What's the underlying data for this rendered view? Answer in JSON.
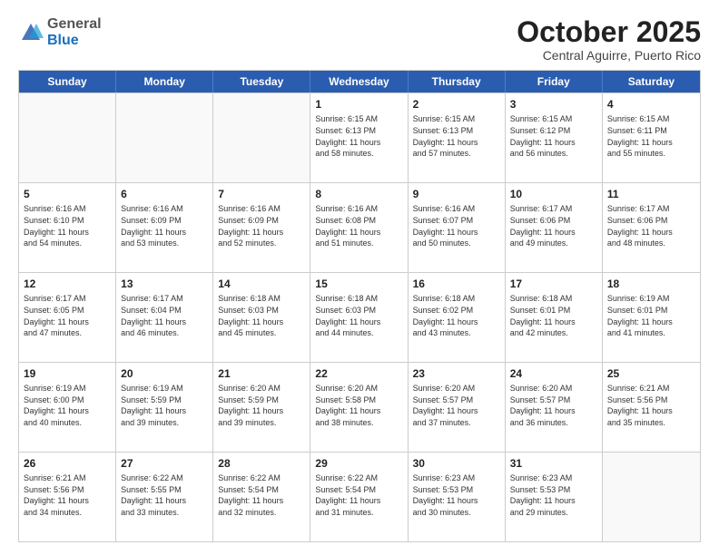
{
  "header": {
    "logo_general": "General",
    "logo_blue": "Blue",
    "month_title": "October 2025",
    "location": "Central Aguirre, Puerto Rico"
  },
  "weekdays": [
    "Sunday",
    "Monday",
    "Tuesday",
    "Wednesday",
    "Thursday",
    "Friday",
    "Saturday"
  ],
  "weeks": [
    [
      {
        "day": "",
        "info": "",
        "empty": true
      },
      {
        "day": "",
        "info": "",
        "empty": true
      },
      {
        "day": "",
        "info": "",
        "empty": true
      },
      {
        "day": "1",
        "info": "Sunrise: 6:15 AM\nSunset: 6:13 PM\nDaylight: 11 hours\nand 58 minutes.",
        "empty": false
      },
      {
        "day": "2",
        "info": "Sunrise: 6:15 AM\nSunset: 6:13 PM\nDaylight: 11 hours\nand 57 minutes.",
        "empty": false
      },
      {
        "day": "3",
        "info": "Sunrise: 6:15 AM\nSunset: 6:12 PM\nDaylight: 11 hours\nand 56 minutes.",
        "empty": false
      },
      {
        "day": "4",
        "info": "Sunrise: 6:15 AM\nSunset: 6:11 PM\nDaylight: 11 hours\nand 55 minutes.",
        "empty": false
      }
    ],
    [
      {
        "day": "5",
        "info": "Sunrise: 6:16 AM\nSunset: 6:10 PM\nDaylight: 11 hours\nand 54 minutes.",
        "empty": false
      },
      {
        "day": "6",
        "info": "Sunrise: 6:16 AM\nSunset: 6:09 PM\nDaylight: 11 hours\nand 53 minutes.",
        "empty": false
      },
      {
        "day": "7",
        "info": "Sunrise: 6:16 AM\nSunset: 6:09 PM\nDaylight: 11 hours\nand 52 minutes.",
        "empty": false
      },
      {
        "day": "8",
        "info": "Sunrise: 6:16 AM\nSunset: 6:08 PM\nDaylight: 11 hours\nand 51 minutes.",
        "empty": false
      },
      {
        "day": "9",
        "info": "Sunrise: 6:16 AM\nSunset: 6:07 PM\nDaylight: 11 hours\nand 50 minutes.",
        "empty": false
      },
      {
        "day": "10",
        "info": "Sunrise: 6:17 AM\nSunset: 6:06 PM\nDaylight: 11 hours\nand 49 minutes.",
        "empty": false
      },
      {
        "day": "11",
        "info": "Sunrise: 6:17 AM\nSunset: 6:06 PM\nDaylight: 11 hours\nand 48 minutes.",
        "empty": false
      }
    ],
    [
      {
        "day": "12",
        "info": "Sunrise: 6:17 AM\nSunset: 6:05 PM\nDaylight: 11 hours\nand 47 minutes.",
        "empty": false
      },
      {
        "day": "13",
        "info": "Sunrise: 6:17 AM\nSunset: 6:04 PM\nDaylight: 11 hours\nand 46 minutes.",
        "empty": false
      },
      {
        "day": "14",
        "info": "Sunrise: 6:18 AM\nSunset: 6:03 PM\nDaylight: 11 hours\nand 45 minutes.",
        "empty": false
      },
      {
        "day": "15",
        "info": "Sunrise: 6:18 AM\nSunset: 6:03 PM\nDaylight: 11 hours\nand 44 minutes.",
        "empty": false
      },
      {
        "day": "16",
        "info": "Sunrise: 6:18 AM\nSunset: 6:02 PM\nDaylight: 11 hours\nand 43 minutes.",
        "empty": false
      },
      {
        "day": "17",
        "info": "Sunrise: 6:18 AM\nSunset: 6:01 PM\nDaylight: 11 hours\nand 42 minutes.",
        "empty": false
      },
      {
        "day": "18",
        "info": "Sunrise: 6:19 AM\nSunset: 6:01 PM\nDaylight: 11 hours\nand 41 minutes.",
        "empty": false
      }
    ],
    [
      {
        "day": "19",
        "info": "Sunrise: 6:19 AM\nSunset: 6:00 PM\nDaylight: 11 hours\nand 40 minutes.",
        "empty": false
      },
      {
        "day": "20",
        "info": "Sunrise: 6:19 AM\nSunset: 5:59 PM\nDaylight: 11 hours\nand 39 minutes.",
        "empty": false
      },
      {
        "day": "21",
        "info": "Sunrise: 6:20 AM\nSunset: 5:59 PM\nDaylight: 11 hours\nand 39 minutes.",
        "empty": false
      },
      {
        "day": "22",
        "info": "Sunrise: 6:20 AM\nSunset: 5:58 PM\nDaylight: 11 hours\nand 38 minutes.",
        "empty": false
      },
      {
        "day": "23",
        "info": "Sunrise: 6:20 AM\nSunset: 5:57 PM\nDaylight: 11 hours\nand 37 minutes.",
        "empty": false
      },
      {
        "day": "24",
        "info": "Sunrise: 6:20 AM\nSunset: 5:57 PM\nDaylight: 11 hours\nand 36 minutes.",
        "empty": false
      },
      {
        "day": "25",
        "info": "Sunrise: 6:21 AM\nSunset: 5:56 PM\nDaylight: 11 hours\nand 35 minutes.",
        "empty": false
      }
    ],
    [
      {
        "day": "26",
        "info": "Sunrise: 6:21 AM\nSunset: 5:56 PM\nDaylight: 11 hours\nand 34 minutes.",
        "empty": false
      },
      {
        "day": "27",
        "info": "Sunrise: 6:22 AM\nSunset: 5:55 PM\nDaylight: 11 hours\nand 33 minutes.",
        "empty": false
      },
      {
        "day": "28",
        "info": "Sunrise: 6:22 AM\nSunset: 5:54 PM\nDaylight: 11 hours\nand 32 minutes.",
        "empty": false
      },
      {
        "day": "29",
        "info": "Sunrise: 6:22 AM\nSunset: 5:54 PM\nDaylight: 11 hours\nand 31 minutes.",
        "empty": false
      },
      {
        "day": "30",
        "info": "Sunrise: 6:23 AM\nSunset: 5:53 PM\nDaylight: 11 hours\nand 30 minutes.",
        "empty": false
      },
      {
        "day": "31",
        "info": "Sunrise: 6:23 AM\nSunset: 5:53 PM\nDaylight: 11 hours\nand 29 minutes.",
        "empty": false
      },
      {
        "day": "",
        "info": "",
        "empty": true
      }
    ]
  ]
}
